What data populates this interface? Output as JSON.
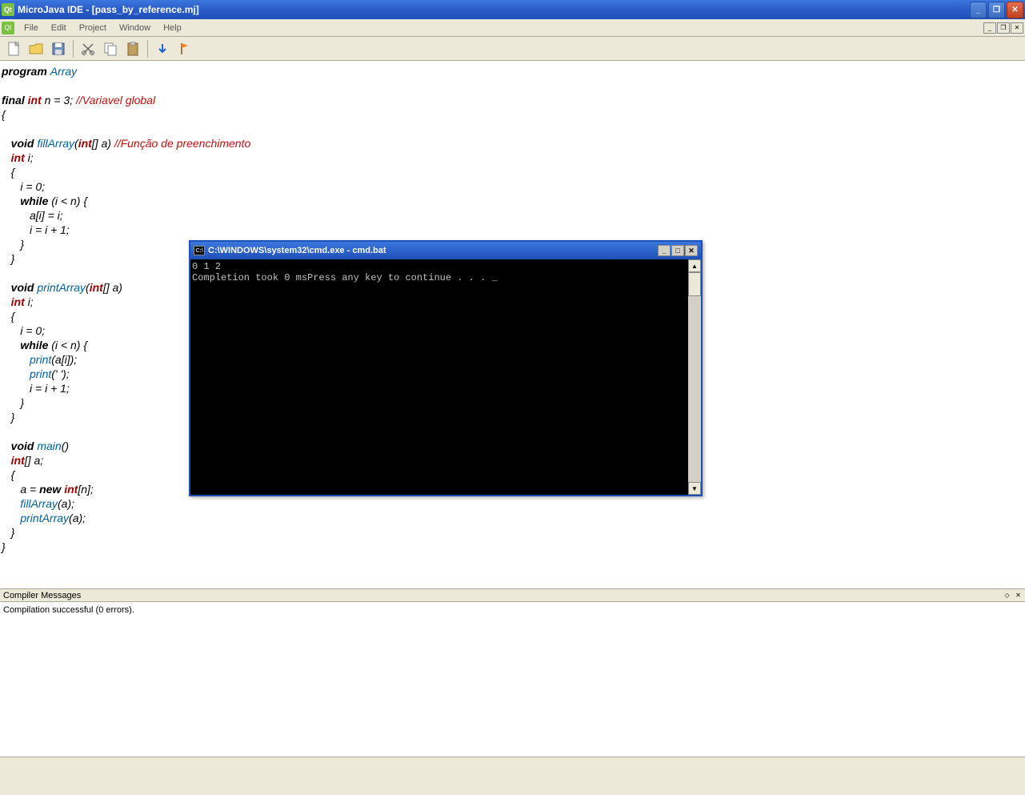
{
  "window": {
    "title": "MicroJava IDE - [pass_by_reference.mj]"
  },
  "menu": {
    "file": "File",
    "edit": "Edit",
    "project": "Project",
    "window": "Window",
    "help": "Help"
  },
  "editor": {
    "code_tokens": [
      [
        [
          "kw",
          "program "
        ],
        [
          "ident",
          "Array"
        ]
      ],
      [],
      [
        [
          "kw",
          "final "
        ],
        [
          "typ",
          "int "
        ],
        [
          "plain",
          "n = 3; "
        ],
        [
          "cmt",
          "//Variavel global"
        ]
      ],
      [
        [
          "plain",
          "{"
        ]
      ],
      [],
      [
        [
          "plain",
          "   "
        ],
        [
          "kw",
          "void "
        ],
        [
          "ident",
          "fillArray"
        ],
        [
          "plain",
          "("
        ],
        [
          "typ",
          "int"
        ],
        [
          "plain",
          "[] a) "
        ],
        [
          "cmt",
          "//Função de preenchimento"
        ]
      ],
      [
        [
          "plain",
          "   "
        ],
        [
          "typ",
          "int "
        ],
        [
          "plain",
          "i;"
        ]
      ],
      [
        [
          "plain",
          "   {"
        ]
      ],
      [
        [
          "plain",
          "      i = 0;"
        ]
      ],
      [
        [
          "plain",
          "      "
        ],
        [
          "kw",
          "while "
        ],
        [
          "plain",
          "(i < n) {"
        ]
      ],
      [
        [
          "plain",
          "         a[i] = i;"
        ]
      ],
      [
        [
          "plain",
          "         i = i + 1;"
        ]
      ],
      [
        [
          "plain",
          "      }"
        ]
      ],
      [
        [
          "plain",
          "   }"
        ]
      ],
      [],
      [
        [
          "plain",
          "   "
        ],
        [
          "kw",
          "void "
        ],
        [
          "ident",
          "printArray"
        ],
        [
          "plain",
          "("
        ],
        [
          "typ",
          "int"
        ],
        [
          "plain",
          "[] a)"
        ]
      ],
      [
        [
          "plain",
          "   "
        ],
        [
          "typ",
          "int "
        ],
        [
          "plain",
          "i;"
        ]
      ],
      [
        [
          "plain",
          "   {"
        ]
      ],
      [
        [
          "plain",
          "      i = 0;"
        ]
      ],
      [
        [
          "plain",
          "      "
        ],
        [
          "kw",
          "while "
        ],
        [
          "plain",
          "(i < n) {"
        ]
      ],
      [
        [
          "plain",
          "         "
        ],
        [
          "ident",
          "print"
        ],
        [
          "plain",
          "(a[i]);"
        ]
      ],
      [
        [
          "plain",
          "         "
        ],
        [
          "ident",
          "print"
        ],
        [
          "plain",
          "(' ');"
        ]
      ],
      [
        [
          "plain",
          "         i = i + 1;"
        ]
      ],
      [
        [
          "plain",
          "      }"
        ]
      ],
      [
        [
          "plain",
          "   }"
        ]
      ],
      [],
      [
        [
          "plain",
          "   "
        ],
        [
          "kw",
          "void "
        ],
        [
          "ident",
          "main"
        ],
        [
          "plain",
          "()"
        ]
      ],
      [
        [
          "plain",
          "   "
        ],
        [
          "typ",
          "int"
        ],
        [
          "plain",
          "[] a;"
        ]
      ],
      [
        [
          "plain",
          "   {"
        ]
      ],
      [
        [
          "plain",
          "      a = "
        ],
        [
          "kw",
          "new "
        ],
        [
          "typ",
          "int"
        ],
        [
          "plain",
          "[n];"
        ]
      ],
      [
        [
          "plain",
          "      "
        ],
        [
          "ident",
          "fillArray"
        ],
        [
          "plain",
          "(a);"
        ]
      ],
      [
        [
          "plain",
          "      "
        ],
        [
          "ident",
          "printArray"
        ],
        [
          "plain",
          "(a);"
        ]
      ],
      [
        [
          "plain",
          "   }"
        ]
      ],
      [
        [
          "plain",
          "}"
        ]
      ]
    ]
  },
  "compiler": {
    "header": "Compiler Messages",
    "message": "Compilation successful (0 errors)."
  },
  "cmd": {
    "title": "C:\\WINDOWS\\system32\\cmd.exe - cmd.bat",
    "line1": "0 1 2 ",
    "line2": "Completion took 0 msPress any key to continue . . . _"
  }
}
